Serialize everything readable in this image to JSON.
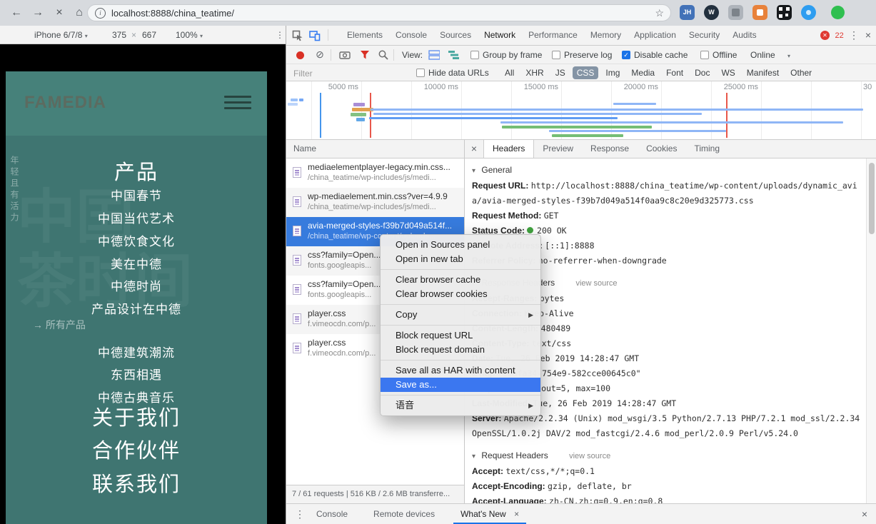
{
  "icons": {
    "back": "←",
    "forward": "→",
    "stop": "×",
    "home": "⌂",
    "star": "☆",
    "overflow": "⋮",
    "close": "×",
    "caret": "▾",
    "submenu": "▶",
    "check": "✓",
    "clear": "⊘",
    "section_arrow": "▾",
    "times_dim": "×",
    "info": "i",
    "error_x": "✕"
  },
  "browser": {
    "url": "localhost:8888/china_teatime/",
    "extensions": {
      "jh": "JH",
      "w": "W"
    }
  },
  "device_toolbar": {
    "device": "iPhone 6/7/8",
    "width": "375",
    "height": "667",
    "zoom": "100%"
  },
  "site": {
    "logo": "FAMEDIA",
    "tagline_vertical": "年轻且有活力",
    "watermark_line1": "中国",
    "watermark_line2": "茶时间",
    "menu": [
      "产品",
      "中国春节",
      "中国当代艺术",
      "中德饮食文化",
      "美在中德",
      "中德时尚",
      "产品设计在中德",
      "→ 所有产品",
      "中德建筑潮流",
      "东西相遇",
      "中德古典音乐",
      "关于我们",
      "合作伙伴",
      "联系我们"
    ]
  },
  "devtools": {
    "tabs": [
      "Elements",
      "Console",
      "Sources",
      "Network",
      "Performance",
      "Memory",
      "Application",
      "Security",
      "Audits"
    ],
    "active_tab": "Network",
    "error_count": "22",
    "network_toolbar": {
      "view_label": "View:",
      "group_by_frame": "Group by frame",
      "preserve_log": "Preserve log",
      "disable_cache": "Disable cache",
      "offline": "Offline",
      "online": "Online"
    },
    "filter_bar": {
      "placeholder": "Filter",
      "hide_data_urls": "Hide data URLs",
      "types": [
        "All",
        "XHR",
        "JS",
        "CSS",
        "Img",
        "Media",
        "Font",
        "Doc",
        "WS",
        "Manifest",
        "Other"
      ],
      "active_type": "CSS"
    },
    "timeline_labels": [
      "5000 ms",
      "10000 ms",
      "15000 ms",
      "20000 ms",
      "25000 ms",
      "30"
    ],
    "requests": {
      "header": "Name",
      "rows": [
        {
          "name": "mediaelementplayer-legacy.min.css...",
          "path": "/china_teatime/wp-includes/js/medi..."
        },
        {
          "name": "wp-mediaelement.min.css?ver=4.9.9",
          "path": "/china_teatime/wp-includes/js/medi..."
        },
        {
          "name": "avia-merged-styles-f39b7d049a514f...",
          "path": "/china_teatime/wp-content/uploads..."
        },
        {
          "name": "css?family=Open...",
          "path": "fonts.googleapis..."
        },
        {
          "name": "css?family=Open...",
          "path": "fonts.googleapis..."
        },
        {
          "name": "player.css",
          "path": "f.vimeocdn.com/p..."
        },
        {
          "name": "player.css",
          "path": "f.vimeocdn.com/p..."
        }
      ],
      "summary": "7 / 61 requests | 516 KB / 2.6 MB transferre..."
    },
    "details": {
      "tabs": [
        "Headers",
        "Preview",
        "Response",
        "Cookies",
        "Timing"
      ],
      "active_tab": "Headers",
      "general_title": "General",
      "response_title": "Response Headers",
      "request_title": "Request Headers",
      "view_source": "view source",
      "general": [
        {
          "key": "Request URL:",
          "value": "http://localhost:8888/china_teatime/wp-content/uploads/dynamic_avia/avia-merged-styles-f39b7d049a514f0aa9c8c20e9d325773.css"
        },
        {
          "key": "Request Method:",
          "value": "GET"
        },
        {
          "key": "Status Code:",
          "value": "200 OK"
        },
        {
          "key": "Remote Address:",
          "value": "[::1]:8888"
        },
        {
          "key": "Referrer Policy:",
          "value": "no-referrer-when-downgrade"
        }
      ],
      "response_headers": [
        {
          "key": "Accept-Ranges:",
          "value": "bytes"
        },
        {
          "key": "Connection:",
          "value": "Keep-Alive"
        },
        {
          "key": "Content-Length:",
          "value": "480489"
        },
        {
          "key": "Content-Type:",
          "value": "text/css"
        },
        {
          "key": "Date:",
          "value": "Tue, 26 Feb 2019 14:28:47 GMT"
        },
        {
          "key": "ETag:",
          "value": "\"1bafa34-754e9-582cce00645c0\""
        },
        {
          "key": "Keep-Alive:",
          "value": "timeout=5, max=100"
        },
        {
          "key": "Last-Modified:",
          "value": "Tue, 26 Feb 2019 14:28:47 GMT"
        },
        {
          "key": "Server:",
          "value": "Apache/2.2.34 (Unix) mod_wsgi/3.5 Python/2.7.13 PHP/7.2.1 mod_ssl/2.2.34 OpenSSL/1.0.2j DAV/2 mod_fastcgi/2.4.6 mod_perl/2.0.9 Perl/v5.24.0"
        }
      ],
      "request_headers": [
        {
          "key": "Accept:",
          "value": "text/css,*/*;q=0.1"
        },
        {
          "key": "Accept-Encoding:",
          "value": "gzip, deflate, br"
        },
        {
          "key": "Accept-Language:",
          "value": "zh-CN,zh;q=0.9,en;q=0.8"
        }
      ]
    },
    "drawer": {
      "console": "Console",
      "remote_devices": "Remote devices",
      "whats_new": "What's New"
    }
  },
  "context_menu": {
    "open_in_sources": "Open in Sources panel",
    "open_in_new_tab": "Open in new tab",
    "clear_cache": "Clear browser cache",
    "clear_cookies": "Clear browser cookies",
    "copy": "Copy",
    "block_url": "Block request URL",
    "block_domain": "Block request domain",
    "save_har": "Save all as HAR with content",
    "save_as": "Save as...",
    "speech": "语音"
  }
}
